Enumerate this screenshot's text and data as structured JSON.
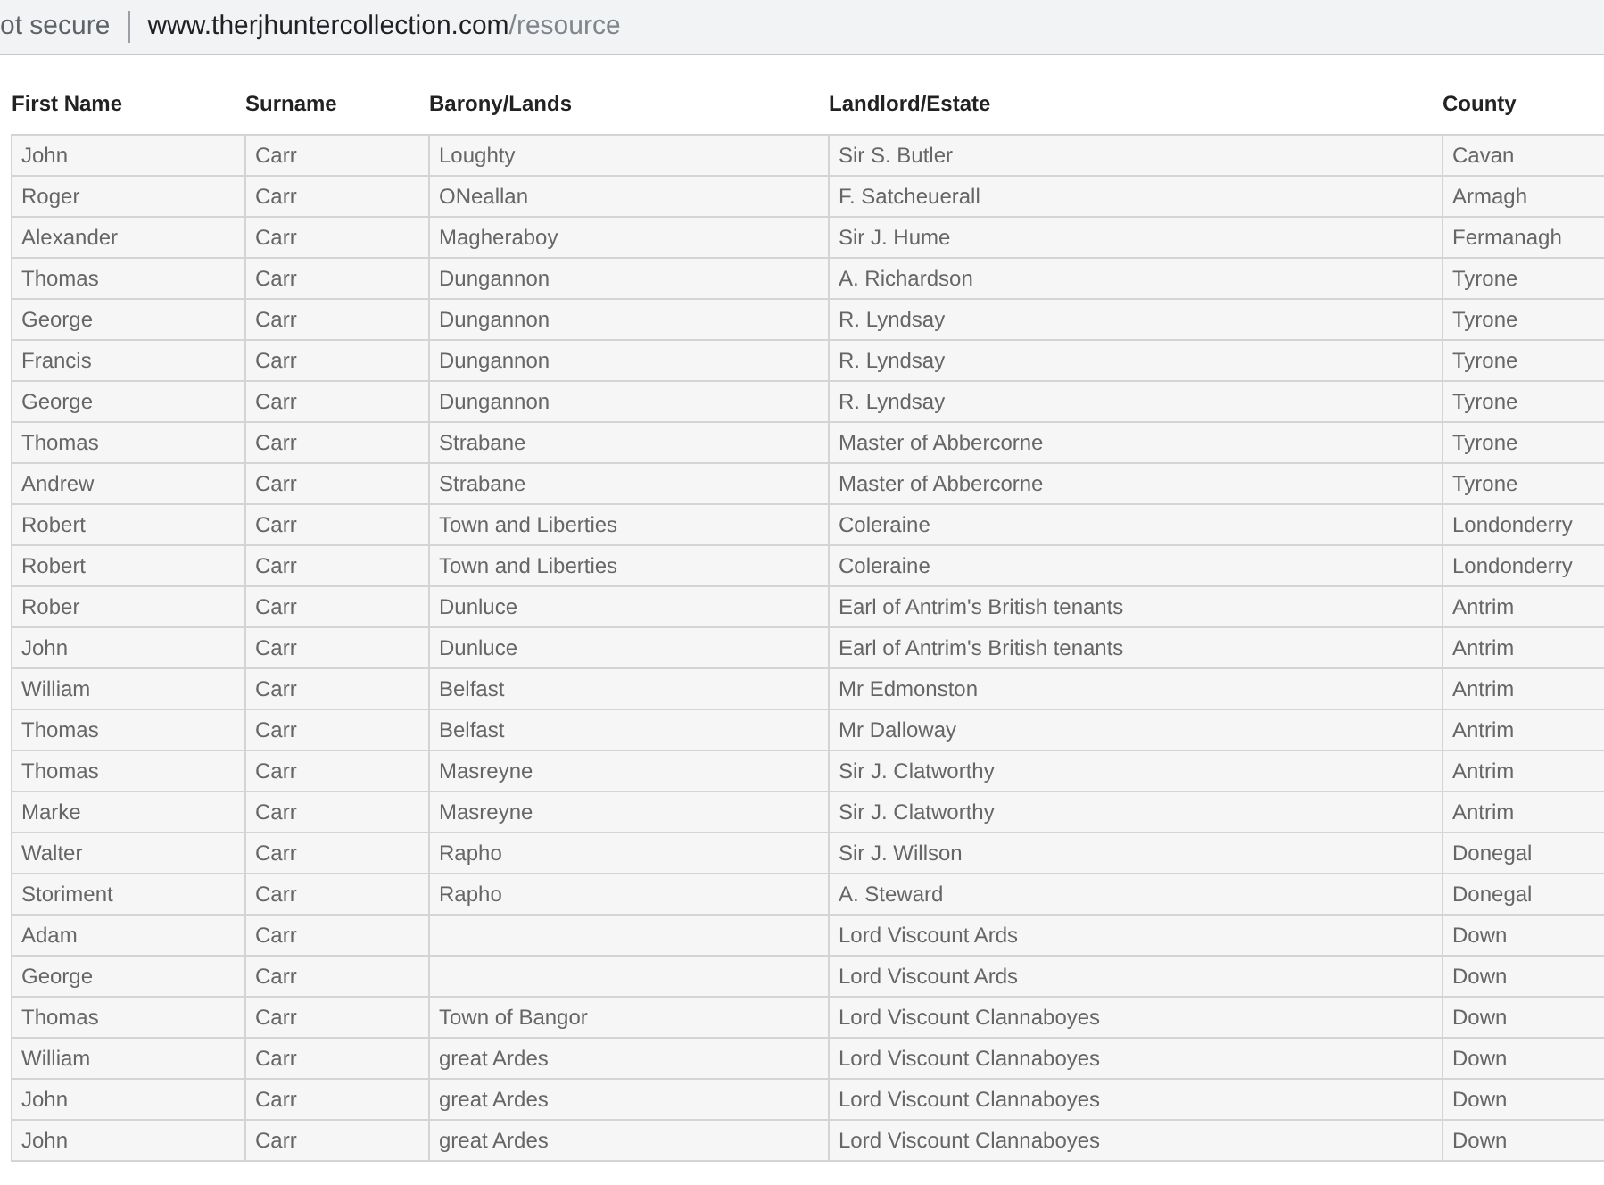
{
  "address_bar": {
    "security": "ot secure",
    "url_host": "www.therjhuntercollection.com",
    "url_path": "/resource"
  },
  "table": {
    "columns": [
      "First Name",
      "Surname",
      "Barony/Lands",
      "Landlord/Estate",
      "County"
    ],
    "rows": [
      [
        "John",
        "Carr",
        "Loughty",
        "Sir S. Butler",
        "Cavan"
      ],
      [
        "Roger",
        "Carr",
        "ONeallan",
        "F. Satcheuerall",
        "Armagh"
      ],
      [
        "Alexander",
        "Carr",
        "Magheraboy",
        "Sir J. Hume",
        "Fermanagh"
      ],
      [
        "Thomas",
        "Carr",
        "Dungannon",
        "A. Richardson",
        "Tyrone"
      ],
      [
        "George",
        "Carr",
        "Dungannon",
        "R. Lyndsay",
        "Tyrone"
      ],
      [
        "Francis",
        "Carr",
        "Dungannon",
        "R. Lyndsay",
        "Tyrone"
      ],
      [
        "George",
        "Carr",
        "Dungannon",
        "R. Lyndsay",
        "Tyrone"
      ],
      [
        "Thomas",
        "Carr",
        "Strabane",
        "Master of Abbercorne",
        "Tyrone"
      ],
      [
        "Andrew",
        "Carr",
        "Strabane",
        "Master of Abbercorne",
        "Tyrone"
      ],
      [
        "Robert",
        "Carr",
        "Town and Liberties",
        "Coleraine",
        "Londonderry"
      ],
      [
        "Robert",
        "Carr",
        "Town and Liberties",
        "Coleraine",
        "Londonderry"
      ],
      [
        "Rober",
        "Carr",
        "Dunluce",
        "Earl of Antrim's British tenants",
        "Antrim"
      ],
      [
        "John",
        "Carr",
        "Dunluce",
        "Earl of Antrim's British tenants",
        "Antrim"
      ],
      [
        "William",
        "Carr",
        "Belfast",
        "Mr Edmonston",
        "Antrim"
      ],
      [
        "Thomas",
        "Carr",
        "Belfast",
        "Mr Dalloway",
        "Antrim"
      ],
      [
        "Thomas",
        "Carr",
        "Masreyne",
        "Sir J. Clatworthy",
        "Antrim"
      ],
      [
        "Marke",
        "Carr",
        "Masreyne",
        "Sir J. Clatworthy",
        "Antrim"
      ],
      [
        "Walter",
        "Carr",
        "Rapho",
        "Sir J. Willson",
        "Donegal"
      ],
      [
        "Storiment",
        "Carr",
        "Rapho",
        "A. Steward",
        "Donegal"
      ],
      [
        "Adam",
        "Carr",
        "",
        "Lord Viscount Ards",
        "Down"
      ],
      [
        "George",
        "Carr",
        "",
        "Lord Viscount Ards",
        "Down"
      ],
      [
        "Thomas",
        "Carr",
        "Town of Bangor",
        "Lord Viscount Clannaboyes",
        "Down"
      ],
      [
        "William",
        "Carr",
        "great Ardes",
        "Lord Viscount Clannaboyes",
        "Down"
      ],
      [
        "John",
        "Carr",
        "great Ardes",
        "Lord Viscount Clannaboyes",
        "Down"
      ],
      [
        "John",
        "Carr",
        "great Ardes",
        "Lord Viscount Clannaboyes",
        "Down"
      ]
    ]
  }
}
